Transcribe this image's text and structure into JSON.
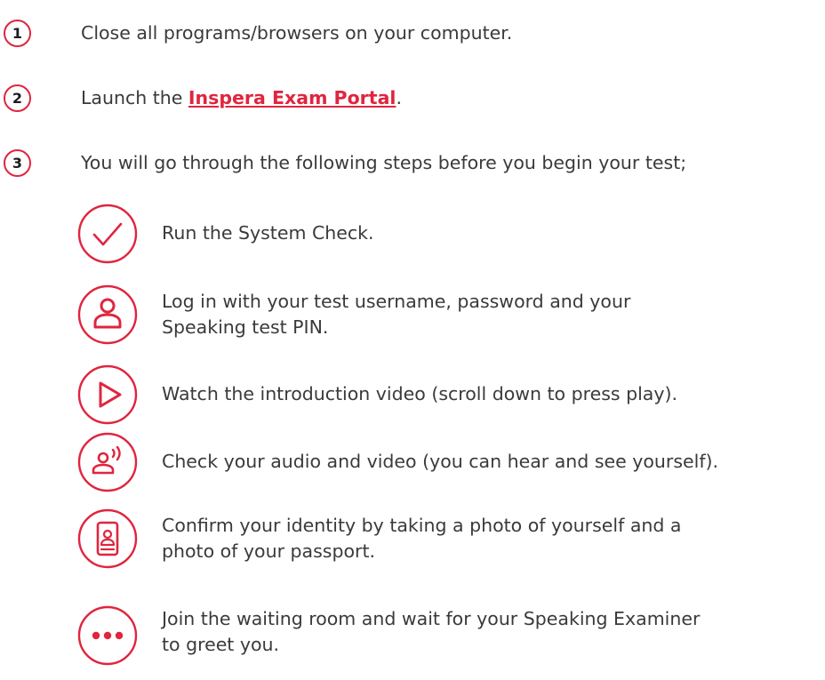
{
  "steps": [
    {
      "number": "1",
      "text": "Close all programs/browsers on your computer."
    },
    {
      "number": "2",
      "text_before": "Launch the ",
      "link": "Inspera Exam Portal",
      "text_after": "."
    },
    {
      "number": "3",
      "text": "You will go through the following steps before you begin your test;"
    }
  ],
  "substeps": [
    {
      "icon": "check-icon",
      "line1": "Run the System Check.",
      "line2": ""
    },
    {
      "icon": "user-icon",
      "line1": "Log in with your test username, password and your",
      "line2": "Speaking test PIN."
    },
    {
      "icon": "play-icon",
      "line1": "Watch the introduction video (scroll down to press play).",
      "line2": ""
    },
    {
      "icon": "audio-video-icon",
      "line1": "Check your audio and video (you can hear and see yourself).",
      "line2": ""
    },
    {
      "icon": "phone-id-icon",
      "line1": "Confirm your identity by taking a photo of yourself and a",
      "line2": "photo of your passport."
    },
    {
      "icon": "more-icon",
      "line1": "Join the waiting room and wait for your Speaking Examiner",
      "line2": "to greet you."
    }
  ],
  "colors": {
    "accent": "#e0253e",
    "text": "#3a3a3a"
  }
}
